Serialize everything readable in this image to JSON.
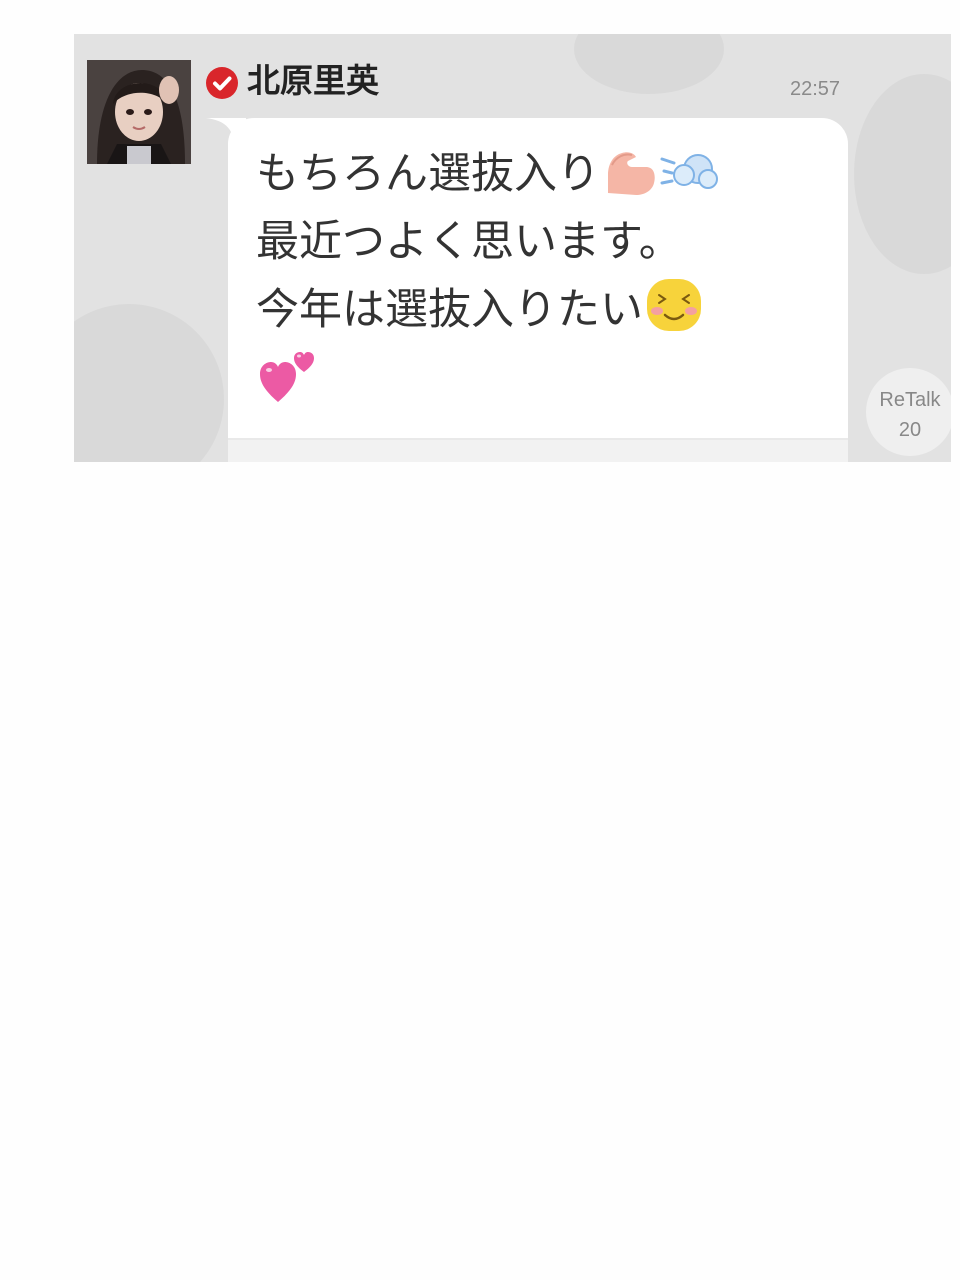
{
  "post": {
    "author": "北原里英",
    "time": "22:57",
    "avatar_icon": "user-photo-avatar",
    "verified_icon": "verified-check-icon",
    "verified_color": "#d9262b",
    "lines": [
      "もちろん選抜入り",
      "最近つよく思います。",
      "今年は選抜入りたい"
    ],
    "emojis": {
      "line1": [
        "flexed-biceps-emoji",
        "dash-emoji"
      ],
      "line3": [
        "smiling-face-emoji"
      ],
      "line4": [
        "two-hearts-emoji"
      ]
    },
    "retalk": {
      "label": "ReTalk",
      "count": "20"
    }
  }
}
